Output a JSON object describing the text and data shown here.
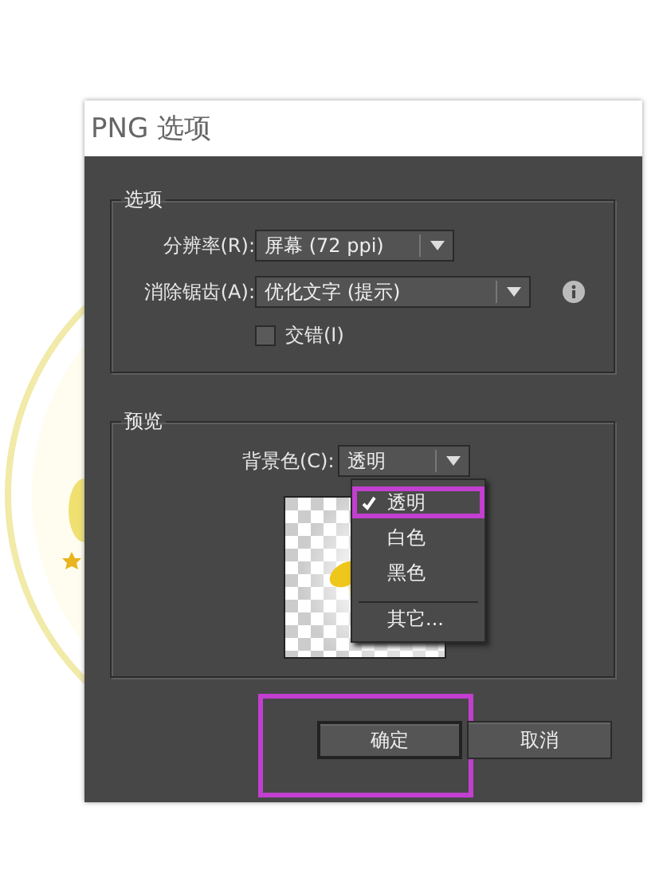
{
  "window": {
    "title": "PNG 选项"
  },
  "options_group": {
    "title": "选项",
    "resolution": {
      "label": "分辨率(R):",
      "value": "屏幕 (72 ppi)"
    },
    "anti_alias": {
      "label": "消除锯齿(A):",
      "value": "优化文字 (提示)"
    },
    "interlace": {
      "label": "交错(I)",
      "checked": false
    }
  },
  "preview_group": {
    "title": "预览",
    "background": {
      "label": "背景色(C):",
      "value": "透明",
      "expanded": true,
      "menu": [
        {
          "label": "透明",
          "selected": true,
          "annotated": true,
          "separator_before": false
        },
        {
          "label": "白色",
          "selected": false,
          "annotated": false,
          "separator_before": false
        },
        {
          "label": "黑色",
          "selected": false,
          "annotated": false,
          "separator_before": false
        },
        {
          "label": "其它...",
          "selected": false,
          "annotated": false,
          "separator_before": true
        }
      ]
    }
  },
  "buttons": [
    {
      "label": "确定",
      "default": true,
      "annotated": true
    },
    {
      "label": "取消",
      "default": false,
      "annotated": false
    }
  ]
}
